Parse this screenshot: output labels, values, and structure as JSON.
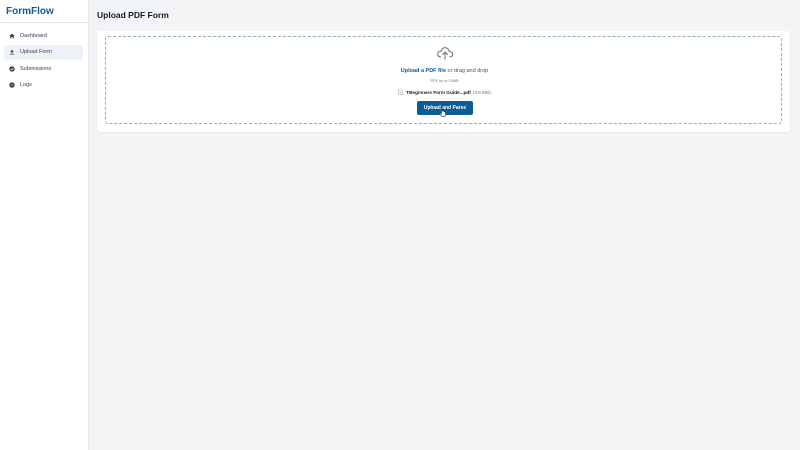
{
  "app": {
    "name": "FormFlow"
  },
  "sidebar": {
    "items": [
      {
        "label": "Dashboard",
        "icon": "home-icon",
        "active": false
      },
      {
        "label": "Upload Form",
        "icon": "upload-icon",
        "active": true
      },
      {
        "label": "Submissions",
        "icon": "check-circle-icon",
        "active": false
      },
      {
        "label": "Logs",
        "icon": "clock-icon",
        "active": false
      }
    ]
  },
  "page": {
    "title": "Upload PDF Form"
  },
  "dropzone": {
    "link_text": "Upload a PDF file",
    "rest_text": "or drag and drop",
    "hint": "PDF up to 10MB",
    "file": {
      "name": "TBeginners Form Guide...pdf",
      "size": "(3.6 MB)"
    },
    "button_label": "Upload and Parse"
  },
  "colors": {
    "accent": "#0e5c95",
    "dropzone_border": "#8fb3ae",
    "background": "#f3f4f6"
  }
}
